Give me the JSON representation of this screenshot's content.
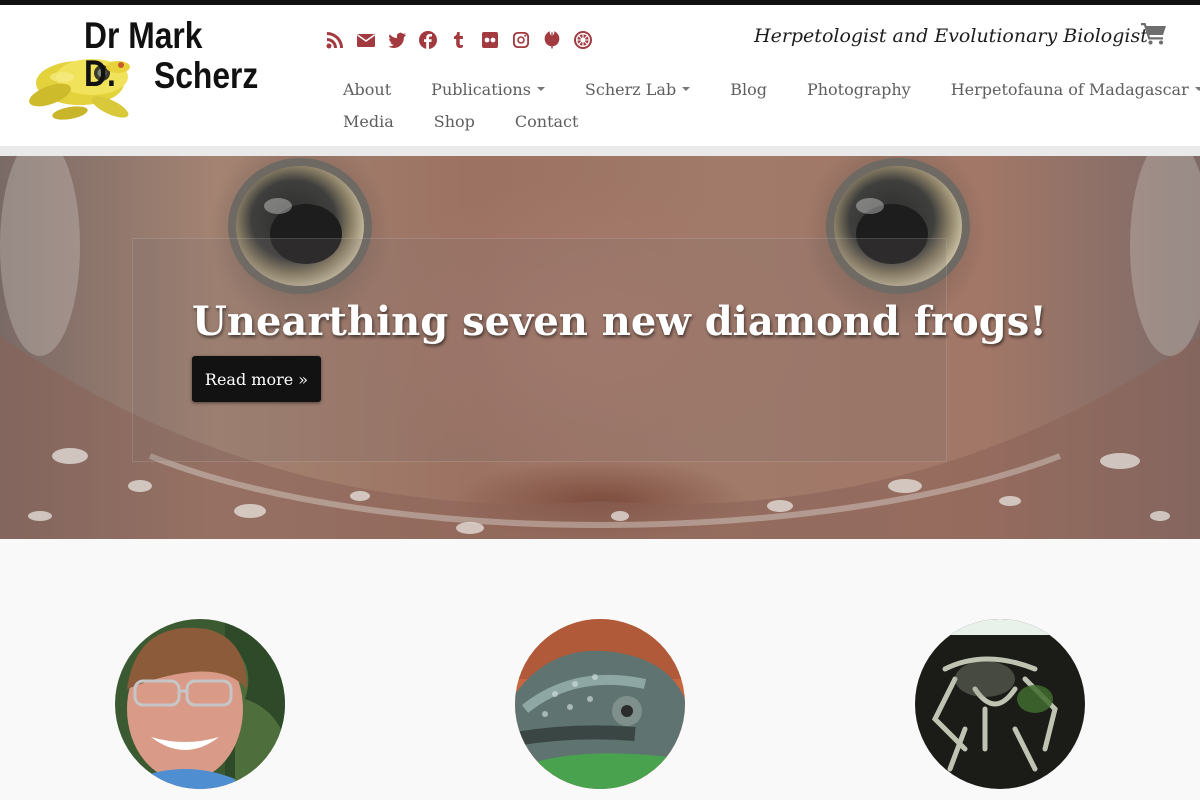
{
  "site": {
    "logo_line1": "Dr Mark D.",
    "logo_line2": "Scherz",
    "tagline": "Herpetologist and Evolutionary Biologist"
  },
  "social": [
    {
      "icon": "rss-icon"
    },
    {
      "icon": "envelope-icon"
    },
    {
      "icon": "twitter-icon"
    },
    {
      "icon": "facebook-icon"
    },
    {
      "icon": "tumblr-icon"
    },
    {
      "icon": "flickr-icon"
    },
    {
      "icon": "instagram-icon"
    },
    {
      "icon": "rebel-icon"
    },
    {
      "icon": "empire-icon"
    }
  ],
  "nav": {
    "row1": [
      {
        "label": "About",
        "dropdown": false
      },
      {
        "label": "Publications",
        "dropdown": true
      },
      {
        "label": "Scherz Lab",
        "dropdown": true
      },
      {
        "label": "Blog",
        "dropdown": false
      },
      {
        "label": "Photography",
        "dropdown": false
      },
      {
        "label": "Herpetofauna of Madagascar",
        "dropdown": true
      }
    ],
    "row2": [
      {
        "label": "Media",
        "dropdown": false
      },
      {
        "label": "Shop",
        "dropdown": false
      },
      {
        "label": "Contact",
        "dropdown": false
      }
    ]
  },
  "hero": {
    "title": "Unearthing seven new diamond frogs!",
    "button": "Read more »"
  },
  "colors": {
    "accent": "#a23a3f",
    "topbar": "#111111",
    "button_bg": "#121212"
  },
  "featured": [
    {
      "image": "portrait-photo"
    },
    {
      "image": "chameleon-photo"
    },
    {
      "image": "frog-skeleton-scan"
    }
  ]
}
